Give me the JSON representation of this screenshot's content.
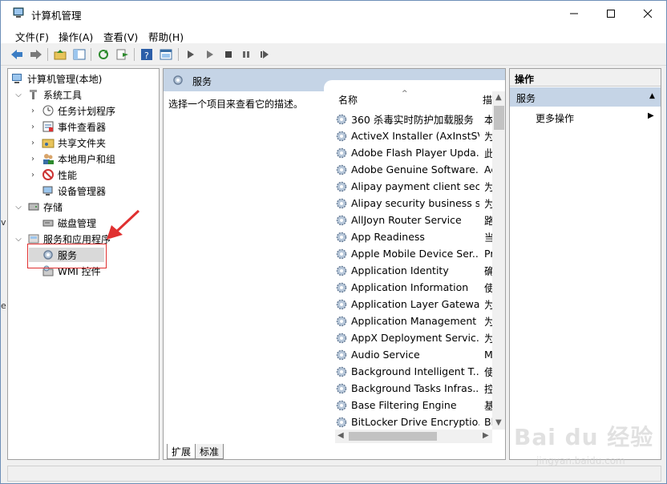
{
  "window": {
    "title": "计算机管理"
  },
  "menu": [
    "文件(F)",
    "操作(A)",
    "查看(V)",
    "帮助(H)"
  ],
  "tree": {
    "root": "计算机管理(本地)",
    "system_tools": "系统工具",
    "items": [
      "任务计划程序",
      "事件查看器",
      "共享文件夹",
      "本地用户和组",
      "性能",
      "设备管理器"
    ],
    "storage": "存储",
    "disk": "磁盘管理",
    "services_apps": "服务和应用程序",
    "services": "服务",
    "wmi": "WMI 控件"
  },
  "middle": {
    "header": "服务",
    "description": "选择一个项目来查看它的描述。",
    "col_name": "名称",
    "col_desc": "描",
    "services": [
      {
        "name": "360 杀毒实时防护加载服务",
        "desc": "本"
      },
      {
        "name": "ActiveX Installer (AxInstSV)",
        "desc": "为"
      },
      {
        "name": "Adobe Flash Player Upda...",
        "desc": "此"
      },
      {
        "name": "Adobe Genuine Software...",
        "desc": "Ac"
      },
      {
        "name": "Alipay payment client sec...",
        "desc": "为"
      },
      {
        "name": "Alipay security business s...",
        "desc": "为"
      },
      {
        "name": "AllJoyn Router Service",
        "desc": "路"
      },
      {
        "name": "App Readiness",
        "desc": "当"
      },
      {
        "name": "Apple Mobile Device Ser...",
        "desc": "Pr"
      },
      {
        "name": "Application Identity",
        "desc": "确"
      },
      {
        "name": "Application Information",
        "desc": "使"
      },
      {
        "name": "Application Layer Gatewa...",
        "desc": "为"
      },
      {
        "name": "Application Management",
        "desc": "为"
      },
      {
        "name": "AppX Deployment Servic...",
        "desc": "为"
      },
      {
        "name": "Audio Service",
        "desc": "M"
      },
      {
        "name": "Background Intelligent T...",
        "desc": "使"
      },
      {
        "name": "Background Tasks Infras...",
        "desc": "控"
      },
      {
        "name": "Base Filtering Engine",
        "desc": "基"
      },
      {
        "name": "BitLocker Drive Encryptio...",
        "desc": "Bl"
      }
    ],
    "tabs": [
      "扩展",
      "标准"
    ]
  },
  "actions": {
    "header": "操作",
    "section": "服务",
    "more": "更多操作"
  },
  "watermark": {
    "main": "Bai du 经验",
    "sub": "jingyan.baidu.com"
  },
  "left_fragments": [
    "v",
    "e"
  ],
  "colors": {
    "pane_header": "#c5d4e6",
    "accent_red": "#e03030"
  }
}
